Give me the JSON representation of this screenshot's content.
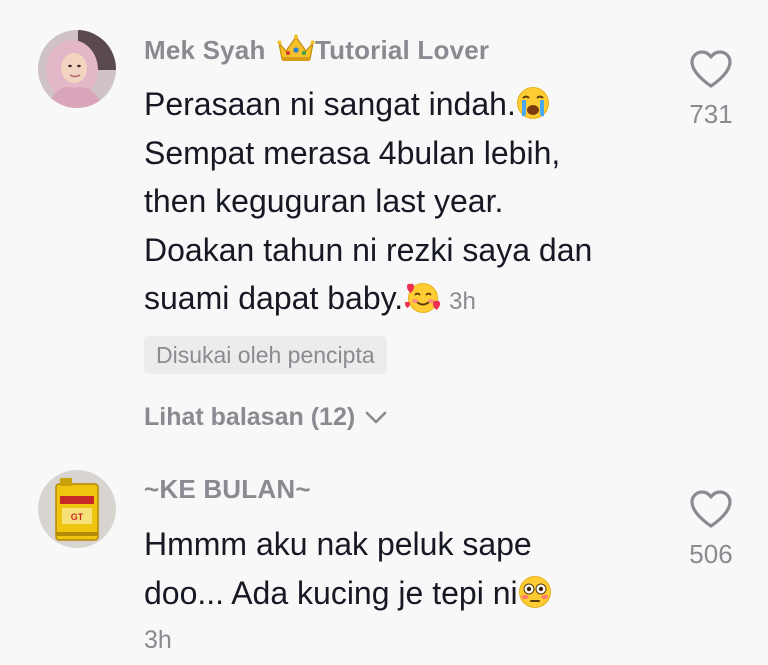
{
  "comments": [
    {
      "username": "Mek Syah",
      "username_suffix": "Tutorial Lover",
      "badge_icon": "crown-icon",
      "lines": [
        "Perasaan ni sangat indah.",
        "Sempat merasa 4bulan lebih,",
        "then keguguran last year.",
        "Doakan tahun ni rezki saya dan",
        "suami dapat baby."
      ],
      "line1_emoji": "crying-face-emoji",
      "line5_emoji": "smiling-face-with-hearts-emoji",
      "timestamp": "3h",
      "likes": "731",
      "creator_liked_label": "Disukai oleh pencipta",
      "view_replies_label": "Lihat balasan (12)"
    },
    {
      "username": "~KE BULAN~",
      "lines": [
        "Hmmm aku nak peluk sape",
        "doo... Ada kucing je tepi ni"
      ],
      "line2_emoji": "flushed-face-emoji",
      "timestamp": "3h",
      "likes": "506"
    }
  ],
  "colors": {
    "background": "#f8f8f8",
    "text_primary": "#161823",
    "text_secondary": "#8a8b91",
    "badge_bg": "#ececec"
  }
}
